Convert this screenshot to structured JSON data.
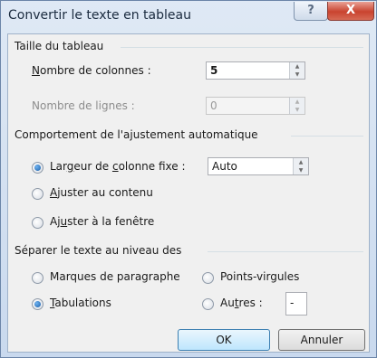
{
  "window": {
    "title": "Convertir le texte en tableau",
    "help_label": "?",
    "close_label": "X"
  },
  "taille": {
    "label": "Taille du tableau",
    "colonnes": {
      "label_mnemonic": "N",
      "label_rest": "ombre de colonnes :",
      "value": "5"
    },
    "lignes": {
      "label": "Nombre de lignes :",
      "value": "0"
    }
  },
  "ajustement": {
    "label": "Comportement de l'ajustement automatique",
    "largeur_fixe": {
      "pre": "Lar",
      "mnemonic1": "g",
      "mid": "eur de ",
      "mnemonic2": "c",
      "post": "olonne fixe :",
      "value": "Auto"
    },
    "contenu": {
      "mnemonic": "A",
      "rest": "juster au contenu"
    },
    "fenetre": {
      "pre": "Aj",
      "mnemonic": "u",
      "post": "ster à la fenêtre"
    }
  },
  "separer": {
    "label": "Séparer le texte au niveau des",
    "paragraphe": {
      "label": "Marques de paragraphe"
    },
    "points_virgules": {
      "label": "Points-virgules"
    },
    "tabulations": {
      "mnemonic": "T",
      "rest": "abulations"
    },
    "autres": {
      "pre": "Au",
      "mnemonic": "t",
      "post": "res :",
      "value": "-"
    }
  },
  "buttons": {
    "ok": "OK",
    "annuler": "Annuler"
  },
  "state": {
    "ajustement_selected": "largeur_fixe",
    "separer_selected": "tabulations"
  }
}
